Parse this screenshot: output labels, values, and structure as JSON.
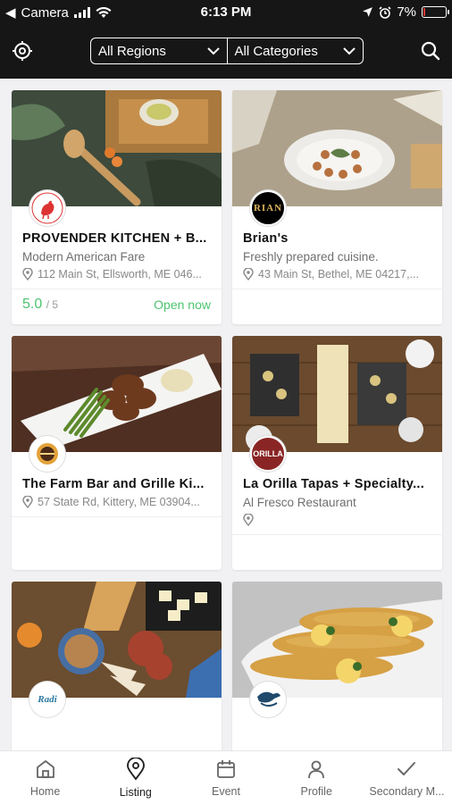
{
  "status_bar": {
    "carrier": "Camera",
    "time": "6:13 PM",
    "battery": "7%",
    "battery_level": 0.07,
    "battery_color": "#e53935"
  },
  "header": {
    "left_icon": "crosshair-icon",
    "region_filter": "All Regions",
    "category_filter": "All Categories",
    "right_icon": "search-icon"
  },
  "cards": [
    {
      "title": "PROVENDER KITCHEN + B...",
      "subtitle": "Modern American Fare",
      "address": "112 Main St, Ellsworth, ME 046...",
      "rating": "5.0",
      "rating_max": "/ 5",
      "open_status": "Open now",
      "logo": "rooster-logo"
    },
    {
      "title": "Brian's",
      "subtitle": "Freshly prepared cuisine.",
      "address": "43 Main St, Bethel, ME 04217,...",
      "logo_text": "RIAN",
      "logo": "brians-logo"
    },
    {
      "title": "The Farm Bar and Grille Ki...",
      "address": "57 State Rd, Kittery, ME 03904...",
      "logo": "farm-bar-logo"
    },
    {
      "title": "La Orilla Tapas + Specialty...",
      "subtitle": "Al Fresco Restaurant",
      "address": "",
      "logo_text": "ORILLA",
      "logo": "la-orilla-logo"
    },
    {
      "title": "",
      "logo_text": "Radi",
      "logo": "tile-logo"
    },
    {
      "title": "",
      "logo": "fish-logo"
    }
  ],
  "tabs": [
    {
      "label": "Home",
      "icon": "home-icon"
    },
    {
      "label": "Listing",
      "icon": "map-pin-icon",
      "active": true
    },
    {
      "label": "Event",
      "icon": "calendar-icon"
    },
    {
      "label": "Profile",
      "icon": "user-icon"
    },
    {
      "label": "Secondary M...",
      "icon": "check-icon"
    }
  ],
  "colors": {
    "header_bg": "#161616",
    "accent_green": "#4cc46e",
    "page_bg": "#f1f1f3"
  }
}
